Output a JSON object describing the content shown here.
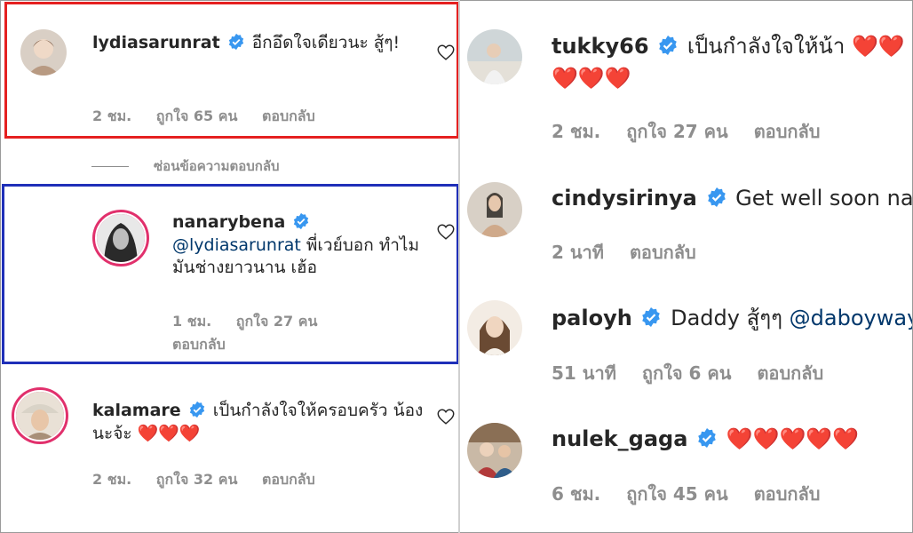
{
  "colors": {
    "red_box": "#e52020",
    "blue_box": "#1f2fb8",
    "verified": "#3897f0",
    "heart": "#e02020",
    "meta": "#8e8e8e",
    "mention": "#00376b"
  },
  "left": {
    "hide_replies": "ซ่อนข้อความตอบกลับ",
    "comments": [
      {
        "username": "lydiasarunrat",
        "text": "อีกอึดใจเดียวนะ สู้ๆ!",
        "time": "2 ชม.",
        "likes": "ถูกใจ 65 คน",
        "reply": "ตอบกลับ"
      },
      {
        "username": "nanarybena",
        "mention": "@lydiasarunrat",
        "text": "พี่เวย์บอก ทำไมมันช่างยาวนาน เฮ้อ",
        "time": "1 ชม.",
        "likes": "ถูกใจ 27 คน",
        "reply": "ตอบกลับ"
      },
      {
        "username": "kalamare",
        "text": "เป็นกำลังใจให้ครอบครัว น้องนะจ้ะ",
        "hearts": "❤️❤️❤️",
        "time": "2 ชม.",
        "likes": "ถูกใจ 32 คน",
        "reply": "ตอบกลับ"
      }
    ]
  },
  "right": {
    "comments": [
      {
        "username": "tukky66",
        "text": "เป็นกำลังใจให้น้า",
        "hearts_line1": "❤️❤️",
        "hearts_line2": "❤️❤️❤️",
        "time": "2 ชม.",
        "likes": "ถูกใจ 27 คน",
        "reply": "ตอบกลับ"
      },
      {
        "username": "cindysirinya",
        "text": "Get well soon naja",
        "time": "2 นาที",
        "reply": "ตอบกลับ"
      },
      {
        "username": "paloyh",
        "text": "Daddy สู้ๆๆ",
        "mention": "@daboyway",
        "time": "51 นาที",
        "likes": "ถูกใจ 6 คน",
        "reply": "ตอบกลับ"
      },
      {
        "username": "nulek_gaga",
        "hearts": "❤️❤️❤️❤️❤️",
        "time": "6 ชม.",
        "likes": "ถูกใจ 45 คน",
        "reply": "ตอบกลับ"
      }
    ]
  },
  "icons": {
    "verified": "verified-badge-icon",
    "like": "heart-outline-icon"
  }
}
